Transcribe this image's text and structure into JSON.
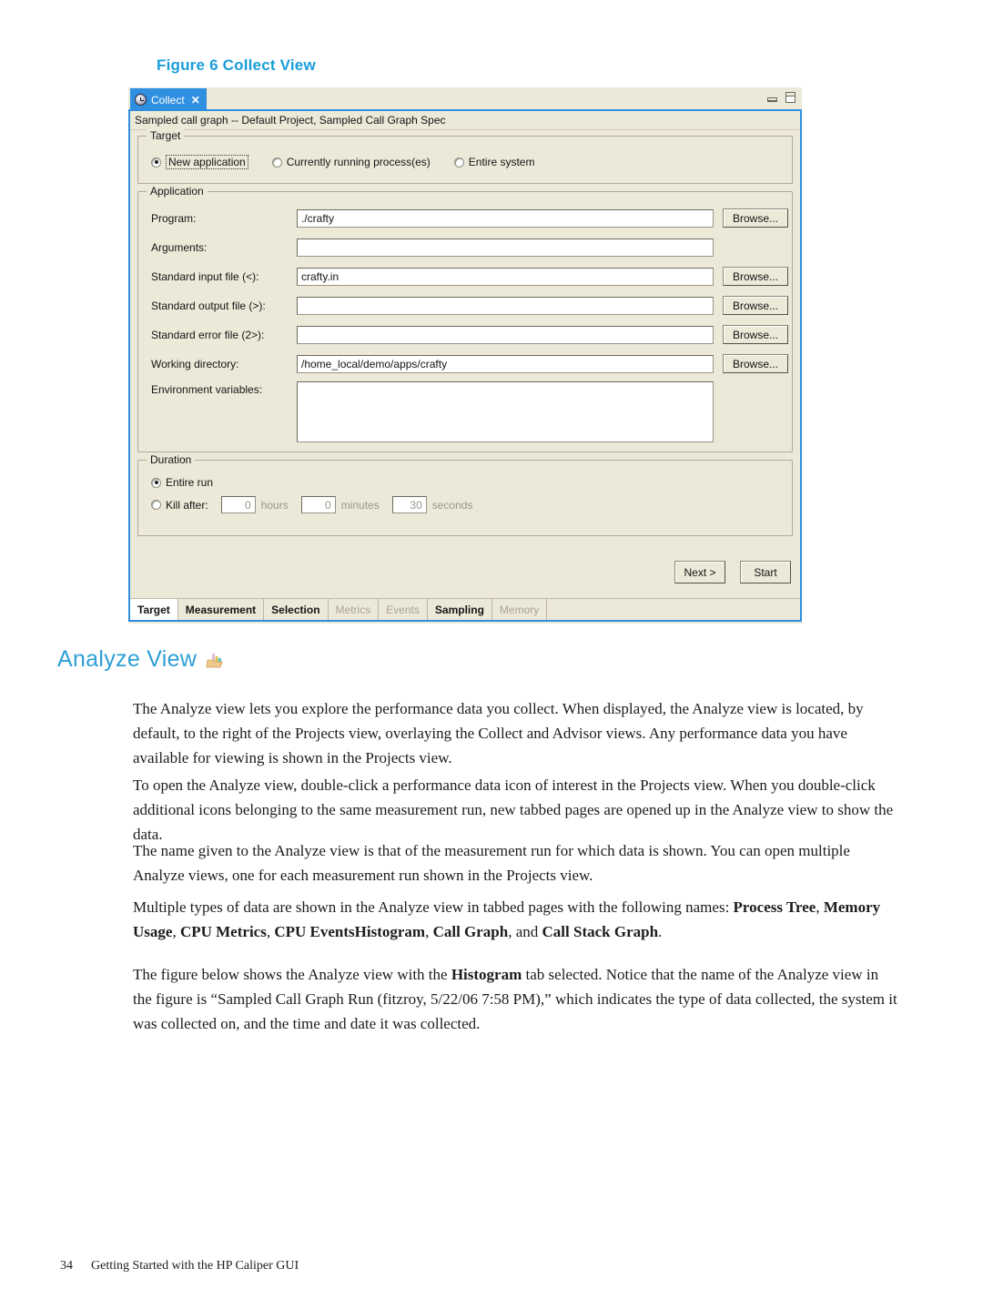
{
  "figure": {
    "caption": "Figure 6 Collect View"
  },
  "window": {
    "tab": {
      "icon": "clock-icon",
      "label": "Collect",
      "close": "✕"
    },
    "controls": {
      "minimize": "minimize-icon",
      "maximize": "maximize-icon"
    },
    "spec_line": "Sampled call graph -- Default Project, Sampled Call Graph Spec",
    "target_group": {
      "legend": "Target",
      "options": [
        {
          "label": "New application",
          "selected": true,
          "focused": true
        },
        {
          "label": "Currently running process(es)",
          "selected": false,
          "focused": false
        },
        {
          "label": "Entire system",
          "selected": false,
          "focused": false
        }
      ]
    },
    "application_group": {
      "legend": "Application",
      "browse_label": "Browse...",
      "fields": [
        {
          "label": "Program:",
          "value": "./crafty",
          "placeholder": "",
          "browse": true
        },
        {
          "label": "Arguments:",
          "value": "",
          "placeholder": "",
          "browse": false
        },
        {
          "label": "Standard input file (<):",
          "value": "crafty.in",
          "placeholder": "",
          "browse": true
        },
        {
          "label": "Standard output file (>):",
          "value": "",
          "placeholder": "",
          "browse": true
        },
        {
          "label": "Standard error file (2>):",
          "value": "",
          "placeholder": "",
          "browse": true
        },
        {
          "label": "Working directory:",
          "value": "/home_local/demo/apps/crafty",
          "placeholder": "",
          "browse": true
        }
      ],
      "env": {
        "label": "Environment variables:",
        "value": ""
      }
    },
    "duration_group": {
      "legend": "Duration",
      "entire_run": {
        "label": "Entire run",
        "selected": true
      },
      "kill_after": {
        "label": "Kill after:",
        "selected": false,
        "hours": {
          "value": "0",
          "unit": "hours"
        },
        "minutes": {
          "value": "0",
          "unit": "minutes"
        },
        "seconds": {
          "value": "30",
          "unit": "seconds"
        }
      }
    },
    "actions": {
      "next": "Next >",
      "start": "Start"
    },
    "bottom_tabs": [
      {
        "label": "Target",
        "selected": true,
        "enabled": true
      },
      {
        "label": "Measurement",
        "selected": false,
        "enabled": true
      },
      {
        "label": "Selection",
        "selected": false,
        "enabled": true
      },
      {
        "label": "Metrics",
        "selected": false,
        "enabled": false
      },
      {
        "label": "Events",
        "selected": false,
        "enabled": false
      },
      {
        "label": "Sampling",
        "selected": false,
        "enabled": true
      },
      {
        "label": "Memory",
        "selected": false,
        "enabled": false
      }
    ]
  },
  "section": {
    "heading": "Analyze View",
    "heading_icon": "bar-chart-folder-icon"
  },
  "body": {
    "p1": "The Analyze view lets you explore the performance data you collect. When displayed, the Analyze view is located, by default, to the right of the Projects view, overlaying the Collect and Advisor views. Any performance data you have available for viewing is shown in the Projects view.",
    "p2": "To open the Analyze view, double-click a performance data icon of interest in the Projects view. When you double-click additional icons belonging to the same measurement run, new tabbed pages are opened up in the Analyze view to show the data.",
    "p3": "The name given to the Analyze view is that of the measurement run for which data is shown. You can open multiple Analyze views, one for each measurement run shown in the Projects view.",
    "p4_pre": "Multiple types of data are shown in the Analyze view in tabbed pages with the following names: ",
    "p4_b1": "Process Tree",
    "p4_s1": ", ",
    "p4_b2": "Memory Usage",
    "p4_s2": ", ",
    "p4_b3": "CPU Metrics",
    "p4_s3": ", ",
    "p4_b4": "CPU EventsHistogram",
    "p4_s4": ", ",
    "p4_b5": "Call Graph",
    "p4_s5": ", and ",
    "p4_b6": "Call Stack Graph",
    "p4_end": ".",
    "p5_pre": "The figure below shows the Analyze view with the ",
    "p5_b1": "Histogram",
    "p5_post": " tab selected. Notice that the name of the Analyze view in the figure is “Sampled Call Graph Run (fitzroy, 5/22/06 7:58 PM),” which indicates the type of data collected, the system it was collected on, and the time and date it was collected."
  },
  "footer": {
    "page_number": "34",
    "text": "Getting Started with the HP Caliper GUI"
  },
  "colors": {
    "accent_blue": "#2f9fd6",
    "tab_blue": "#2f8fe0",
    "dialog_bg": "#ece9d8"
  }
}
